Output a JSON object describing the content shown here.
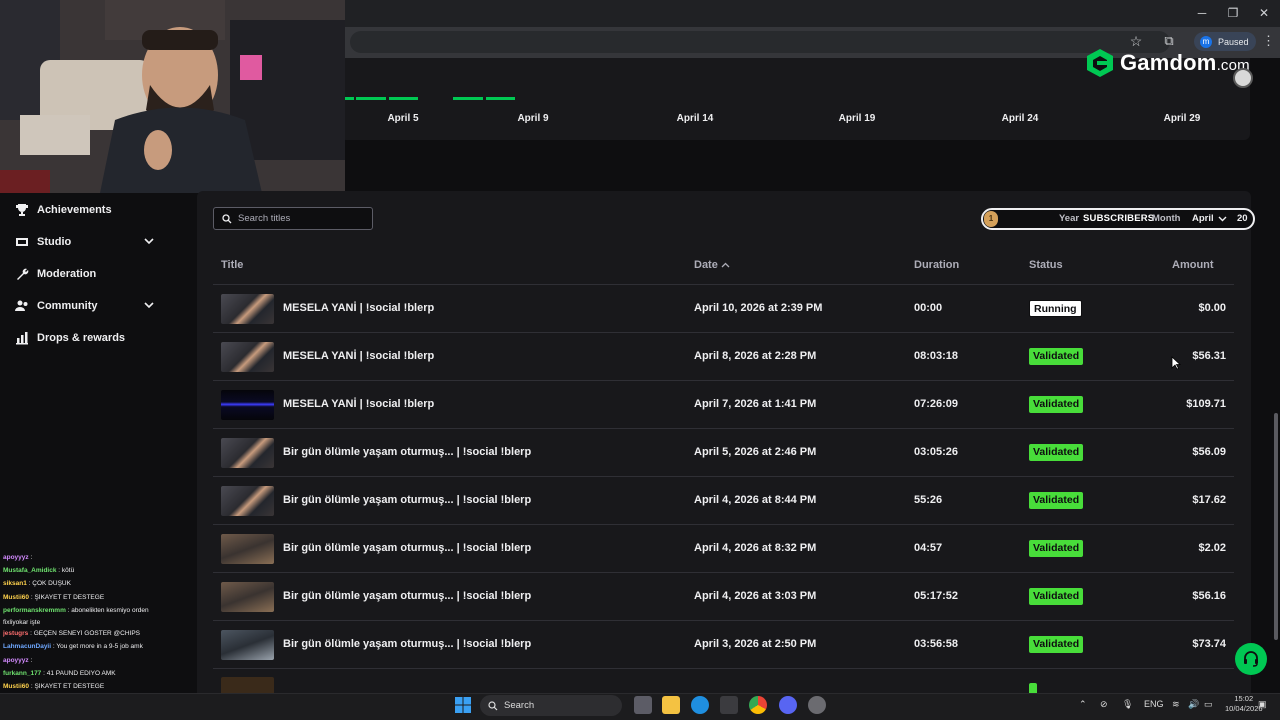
{
  "browser": {
    "profile_initial": "m",
    "profile_status": "Paused",
    "window_controls": {
      "minimize": "─",
      "maximize": "❐",
      "close": "✕"
    }
  },
  "overlay": {
    "brand": "Gamdom",
    "brand_suffix": ".com",
    "brand_color": "#00c853"
  },
  "chart": {
    "date_labels": [
      "April 5",
      "April 9",
      "April 14",
      "April 19",
      "April 24",
      "April 29"
    ],
    "bar_color": "#00c853"
  },
  "sidebar": {
    "items": [
      {
        "label": "Achievements",
        "icon": "trophy-icon",
        "expandable": false
      },
      {
        "label": "Studio",
        "icon": "film-icon",
        "expandable": true
      },
      {
        "label": "Moderation",
        "icon": "wrench-icon",
        "expandable": false
      },
      {
        "label": "Community",
        "icon": "people-icon",
        "expandable": true
      },
      {
        "label": "Drops & rewards",
        "icon": "chart-icon",
        "expandable": false
      }
    ]
  },
  "chat": {
    "lines": [
      {
        "user": "apoyyyz",
        "text": ":",
        "color": "#d38bff"
      },
      {
        "user": "Mustafa_Amidick",
        "text": ": kötü",
        "color": "#6fe36f"
      },
      {
        "user": "siksan1",
        "text": ": ÇOK DÜŞÜK",
        "color": "#ffd24d"
      },
      {
        "user": "Mustii60",
        "text": ": ŞİKAYET ET DESTEĞE",
        "color": "#ffd24d"
      },
      {
        "user": "performanskremmm",
        "text": ": abonelikten kesmiyo orden",
        "color": "#6fe36f"
      },
      {
        "user": "",
        "text": "fixliyokar işte",
        "color": "#efeff1"
      },
      {
        "user": "jestugrs",
        "text": ": GEÇEN SENEYİ GÖSTER @CHIPS",
        "color": "#ff6f6f"
      },
      {
        "user": "LahmacunDayii",
        "text": ": You get more in a 9-5 job amk",
        "color": "#6fa8ff"
      },
      {
        "user": "apoyyyz",
        "text": ":",
        "color": "#d38bff"
      },
      {
        "user": "furkann_177",
        "text": ": 41 PAUND EDİYO AMK",
        "color": "#6fe36f"
      },
      {
        "user": "Mustii60",
        "text": ": ŞİKAYET ET DESTEĞE",
        "color": "#ffd24d"
      }
    ]
  },
  "filters": {
    "search_placeholder": "Search titles",
    "period_year": "Year",
    "period_subscribers": "SUBSCRIBERS",
    "period_month": "Month",
    "period_selected_month": "April",
    "period_value": "20",
    "knob_label": "1"
  },
  "table": {
    "columns": {
      "title": "Title",
      "date": "Date",
      "duration": "Duration",
      "status": "Status",
      "amount": "Amount"
    },
    "rows": [
      {
        "title": "MESELA YANİ | !social !blerp",
        "date": "April 10, 2026 at 2:39 PM",
        "duration": "00:00",
        "status": "Running",
        "amount": "$0.00",
        "thumb": "cam"
      },
      {
        "title": "MESELA YANİ | !social !blerp",
        "date": "April 8, 2026 at 2:28 PM",
        "duration": "08:03:18",
        "status": "Validated",
        "amount": "$56.31",
        "thumb": "cam"
      },
      {
        "title": "MESELA YANİ | !social !blerp",
        "date": "April 7, 2026 at 1:41 PM",
        "duration": "07:26:09",
        "status": "Validated",
        "amount": "$109.71",
        "thumb": "dark"
      },
      {
        "title": "Bir gün ölümle yaşam oturmuş... | !social !blerp",
        "date": "April 5, 2026 at 2:46 PM",
        "duration": "03:05:26",
        "status": "Validated",
        "amount": "$56.09",
        "thumb": "cam"
      },
      {
        "title": "Bir gün ölümle yaşam oturmuş... | !social !blerp",
        "date": "April 4, 2026 at 8:44 PM",
        "duration": "55:26",
        "status": "Validated",
        "amount": "$17.62",
        "thumb": "cam"
      },
      {
        "title": "Bir gün ölümle yaşam oturmuş... | !social !blerp",
        "date": "April 4, 2026 at 8:32 PM",
        "duration": "04:57",
        "status": "Validated",
        "amount": "$2.02",
        "thumb": "game"
      },
      {
        "title": "Bir gün ölümle yaşam oturmuş... | !social !blerp",
        "date": "April 4, 2026 at 3:03 PM",
        "duration": "05:17:52",
        "status": "Validated",
        "amount": "$56.16",
        "thumb": "game"
      },
      {
        "title": "Bir gün ölümle yaşam oturmuş... | !social !blerp",
        "date": "April 3, 2026 at 2:50 PM",
        "duration": "03:56:58",
        "status": "Validated",
        "amount": "$73.74",
        "thumb": "game2"
      }
    ]
  },
  "taskbar": {
    "search_label": "Search",
    "language": "ENG",
    "time": "15:02",
    "date": "10/04/2026"
  },
  "colors": {
    "running_badge": "#ffffff",
    "validated_badge": "#48dd3a",
    "accent_green": "#00c853"
  }
}
